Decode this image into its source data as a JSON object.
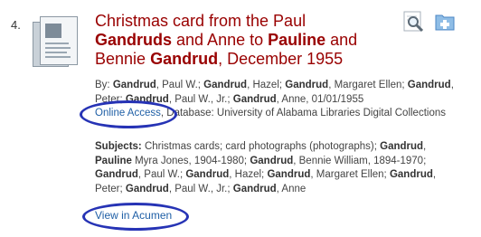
{
  "result": {
    "number": "4.",
    "title_parts": [
      "Christmas card from the Paul ",
      "Gandruds",
      " and Anne to ",
      "Pauline",
      " and Bennie ",
      "Gandrud",
      ", December 1955"
    ],
    "by_label": "By:",
    "by_parts": [
      "Gandrud",
      ", Paul W.; ",
      "Gandrud",
      ", Hazel; ",
      "Gandrud",
      ", Margaret Ellen; ",
      "Gandrud",
      ", Peter; ",
      "Gandrud",
      ", Paul W., Jr.; ",
      "Gandrud",
      ", Anne, 01/01/1955"
    ],
    "online_access": "Online Access",
    "database_text": ", Database: University of Alabama Libraries Digital Collections",
    "subjects_label": "Subjects:",
    "subject_parts": [
      " Christmas cards; card photographs (photographs); ",
      "Gandrud",
      ", ",
      "Pauline",
      " Myra Jones, 1904-1980; ",
      "Gandrud",
      ", Bennie William, 1894-1970; ",
      "Gandrud",
      ", Paul W.; ",
      "Gandrud",
      ", Hazel; ",
      "Gandrud",
      ", Margaret Ellen; ",
      "Gandrud",
      ", Peter; ",
      "Gandrud",
      ", Paul W., Jr.; ",
      "Gandrud",
      ", Anne"
    ],
    "view_link": "View in Acumen"
  },
  "icons": {
    "preview": "magnifier-icon",
    "add": "add-folder-icon"
  },
  "colors": {
    "title": "#990000",
    "link": "#1f5fa6",
    "highlight_circle": "#2633b5"
  }
}
